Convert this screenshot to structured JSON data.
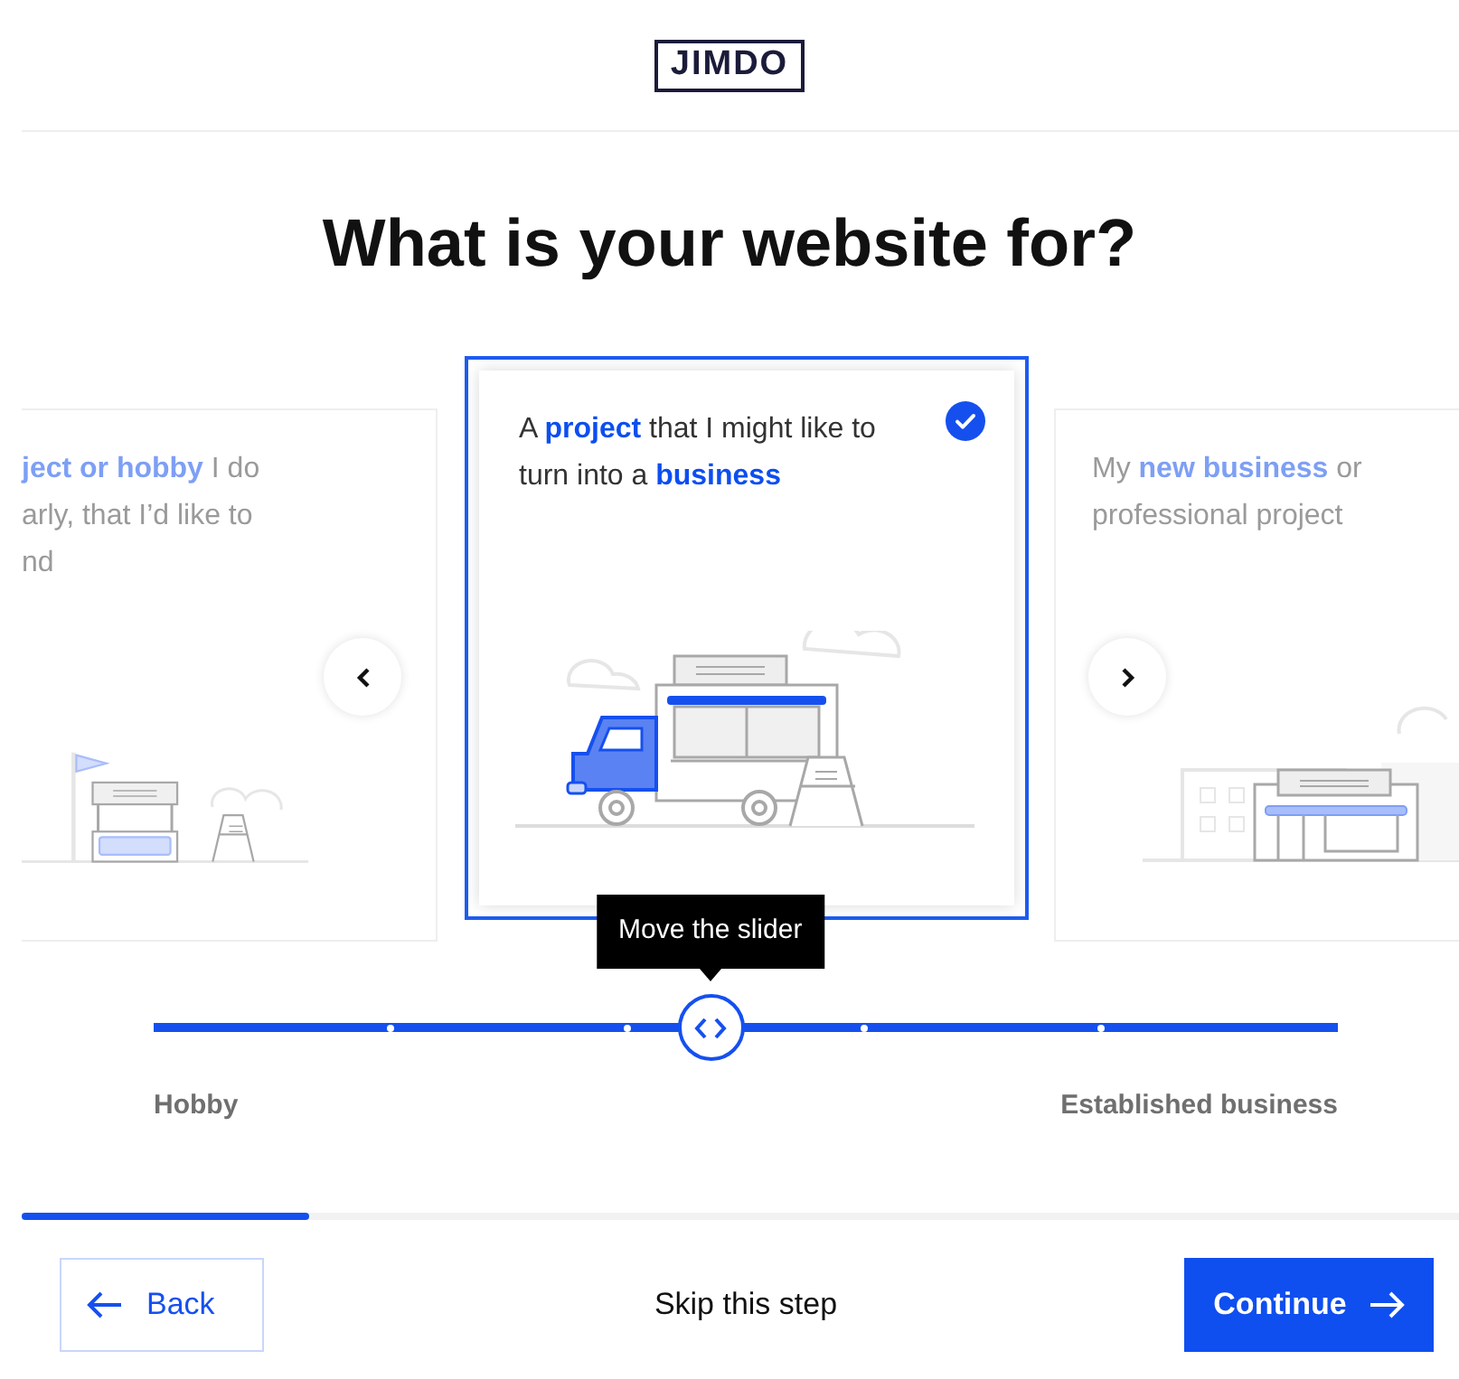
{
  "logo": "JIMDO",
  "title": "What is your website for?",
  "cards": [
    {
      "kind": "stall",
      "lines": [
        "**ject or hobby** I do",
        "arly, that I’d like to",
        "nd"
      ],
      "selected": false
    },
    {
      "kind": "truck",
      "lines": [
        "A **project** that I might like to turn into a **business**"
      ],
      "selected": true
    },
    {
      "kind": "shop",
      "lines": [
        "My **new business** or professional project"
      ],
      "selected": false
    }
  ],
  "slider": {
    "level": 0.47,
    "tooltip": "Move the slider",
    "min_label": "Hobby",
    "max_label": "Established business"
  },
  "progress": {
    "level": 0.2
  },
  "footer": {
    "back": "Back",
    "skip": "Skip this step",
    "continue": "Continue"
  }
}
